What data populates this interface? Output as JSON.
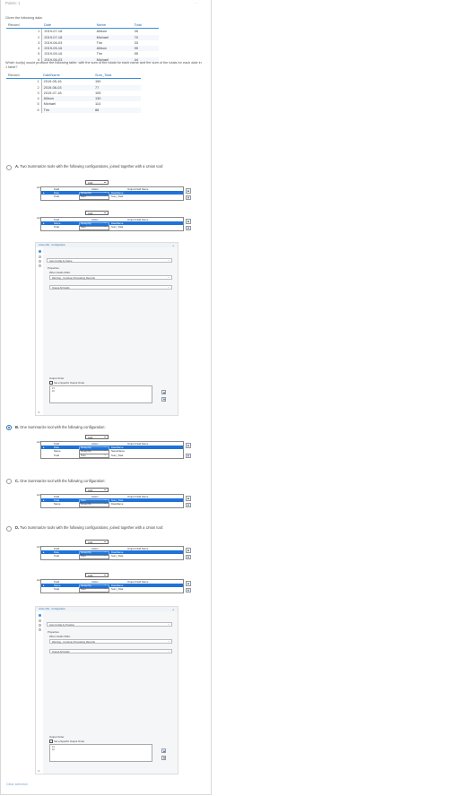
{
  "header": {
    "points": "Points: 1",
    "menu": "…"
  },
  "question": {
    "intro": "Given the following data:",
    "table1": {
      "columns": [
        "Record",
        "Date",
        "Name",
        "Total"
      ],
      "rows": [
        [
          "1",
          "2019-07-18",
          "Allison",
          "35"
        ],
        [
          "2",
          "2019-07-18",
          "Michael",
          "70"
        ],
        [
          "3",
          "2019-06-03",
          "Tim",
          "33"
        ],
        [
          "4",
          "2019-05-16",
          "Allison",
          "95"
        ],
        [
          "5",
          "2019-05-16",
          "Tim",
          "55"
        ],
        [
          "6",
          "2019-06-03",
          "Michael",
          "44"
        ]
      ]
    },
    "prompt": "Which tool(s) would produce the following table, with the sum of the totals for each name and the sum of the totals for each date in 1 table?",
    "table2": {
      "columns": [
        "Record",
        "DateName",
        "Sum_Total"
      ],
      "rows": [
        [
          "1",
          "2019-05-16",
          "150"
        ],
        [
          "2",
          "2019-06-03",
          "77"
        ],
        [
          "3",
          "2019-07-18",
          "105"
        ],
        [
          "4",
          "Allison",
          "130"
        ],
        [
          "5",
          "Michael",
          "114"
        ],
        [
          "6",
          "Tim",
          "88"
        ]
      ]
    }
  },
  "options": [
    {
      "letter": "A.",
      "text": "Two Summarize tools with the following configurations, joined together with a Union tool:",
      "selected": false
    },
    {
      "letter": "B.",
      "text": "One Summarize tool with the following configuration:",
      "selected": true
    },
    {
      "letter": "C.",
      "text": "One Summarize tool with the following configuration:",
      "selected": false
    },
    {
      "letter": "D.",
      "text": "Two Summarize tools with the following configurations, joined together with a Union tool:",
      "selected": false
    }
  ],
  "summarize": {
    "actions_label": "Actions:",
    "add_label": "Add",
    "col_field": "Field",
    "col_action": "Action",
    "col_output": "Output Field Name",
    "a1": [
      [
        "Date",
        "Group By",
        "DateName"
      ],
      [
        "Total",
        "Sum",
        "Sum_Total"
      ]
    ],
    "a2": [
      [
        "Name",
        "Group By",
        "DateName"
      ],
      [
        "Total",
        "Sum",
        "Sum_Total"
      ]
    ],
    "b": [
      [
        "Date",
        "Group By",
        "DateName"
      ],
      [
        "Name",
        "Group By",
        "NameName"
      ],
      [
        "Total",
        "Sum",
        "Sum_Total"
      ]
    ],
    "c": [
      [
        "Total",
        "Sum",
        "Sum_Total"
      ],
      [
        "Name",
        "Group By",
        "DateName"
      ]
    ],
    "d1": [
      [
        "Date",
        "Group By",
        "DateName"
      ],
      [
        "Total",
        "Sum",
        "Sum_Total"
      ]
    ],
    "d2": [
      [
        "Name",
        "Group By",
        "DateName"
      ],
      [
        "Total",
        "Sum",
        "Sum_Total"
      ]
    ]
  },
  "union_a": {
    "title": "Union (20) - Configuration",
    "mode": "Auto Config by Name",
    "properties": "Properties",
    "when_fields_differ": "When Fields Differ:",
    "warning": "Warning - Continue Processing Records",
    "output": "Output All Fields",
    "output_order": "Output Order",
    "set_order": "Set a Specific Output Order",
    "order_items": [
      "#1",
      "#2"
    ]
  },
  "union_d": {
    "title": "Union (20) - Configuration",
    "mode": "Auto Config by Position",
    "properties": "Properties",
    "when_fields_differ": "When Fields Differ:",
    "warning": "Warning - Continue Processing Records",
    "output": "Output All Fields",
    "output_order": "Output Order",
    "set_order": "Set a Specific Output Order",
    "order_items": [
      "#1",
      "#2"
    ]
  },
  "footer": {
    "clear": "Clear selection"
  },
  "colors": {
    "accent": "#2a6db0",
    "selected_row": "#1e73d8"
  }
}
